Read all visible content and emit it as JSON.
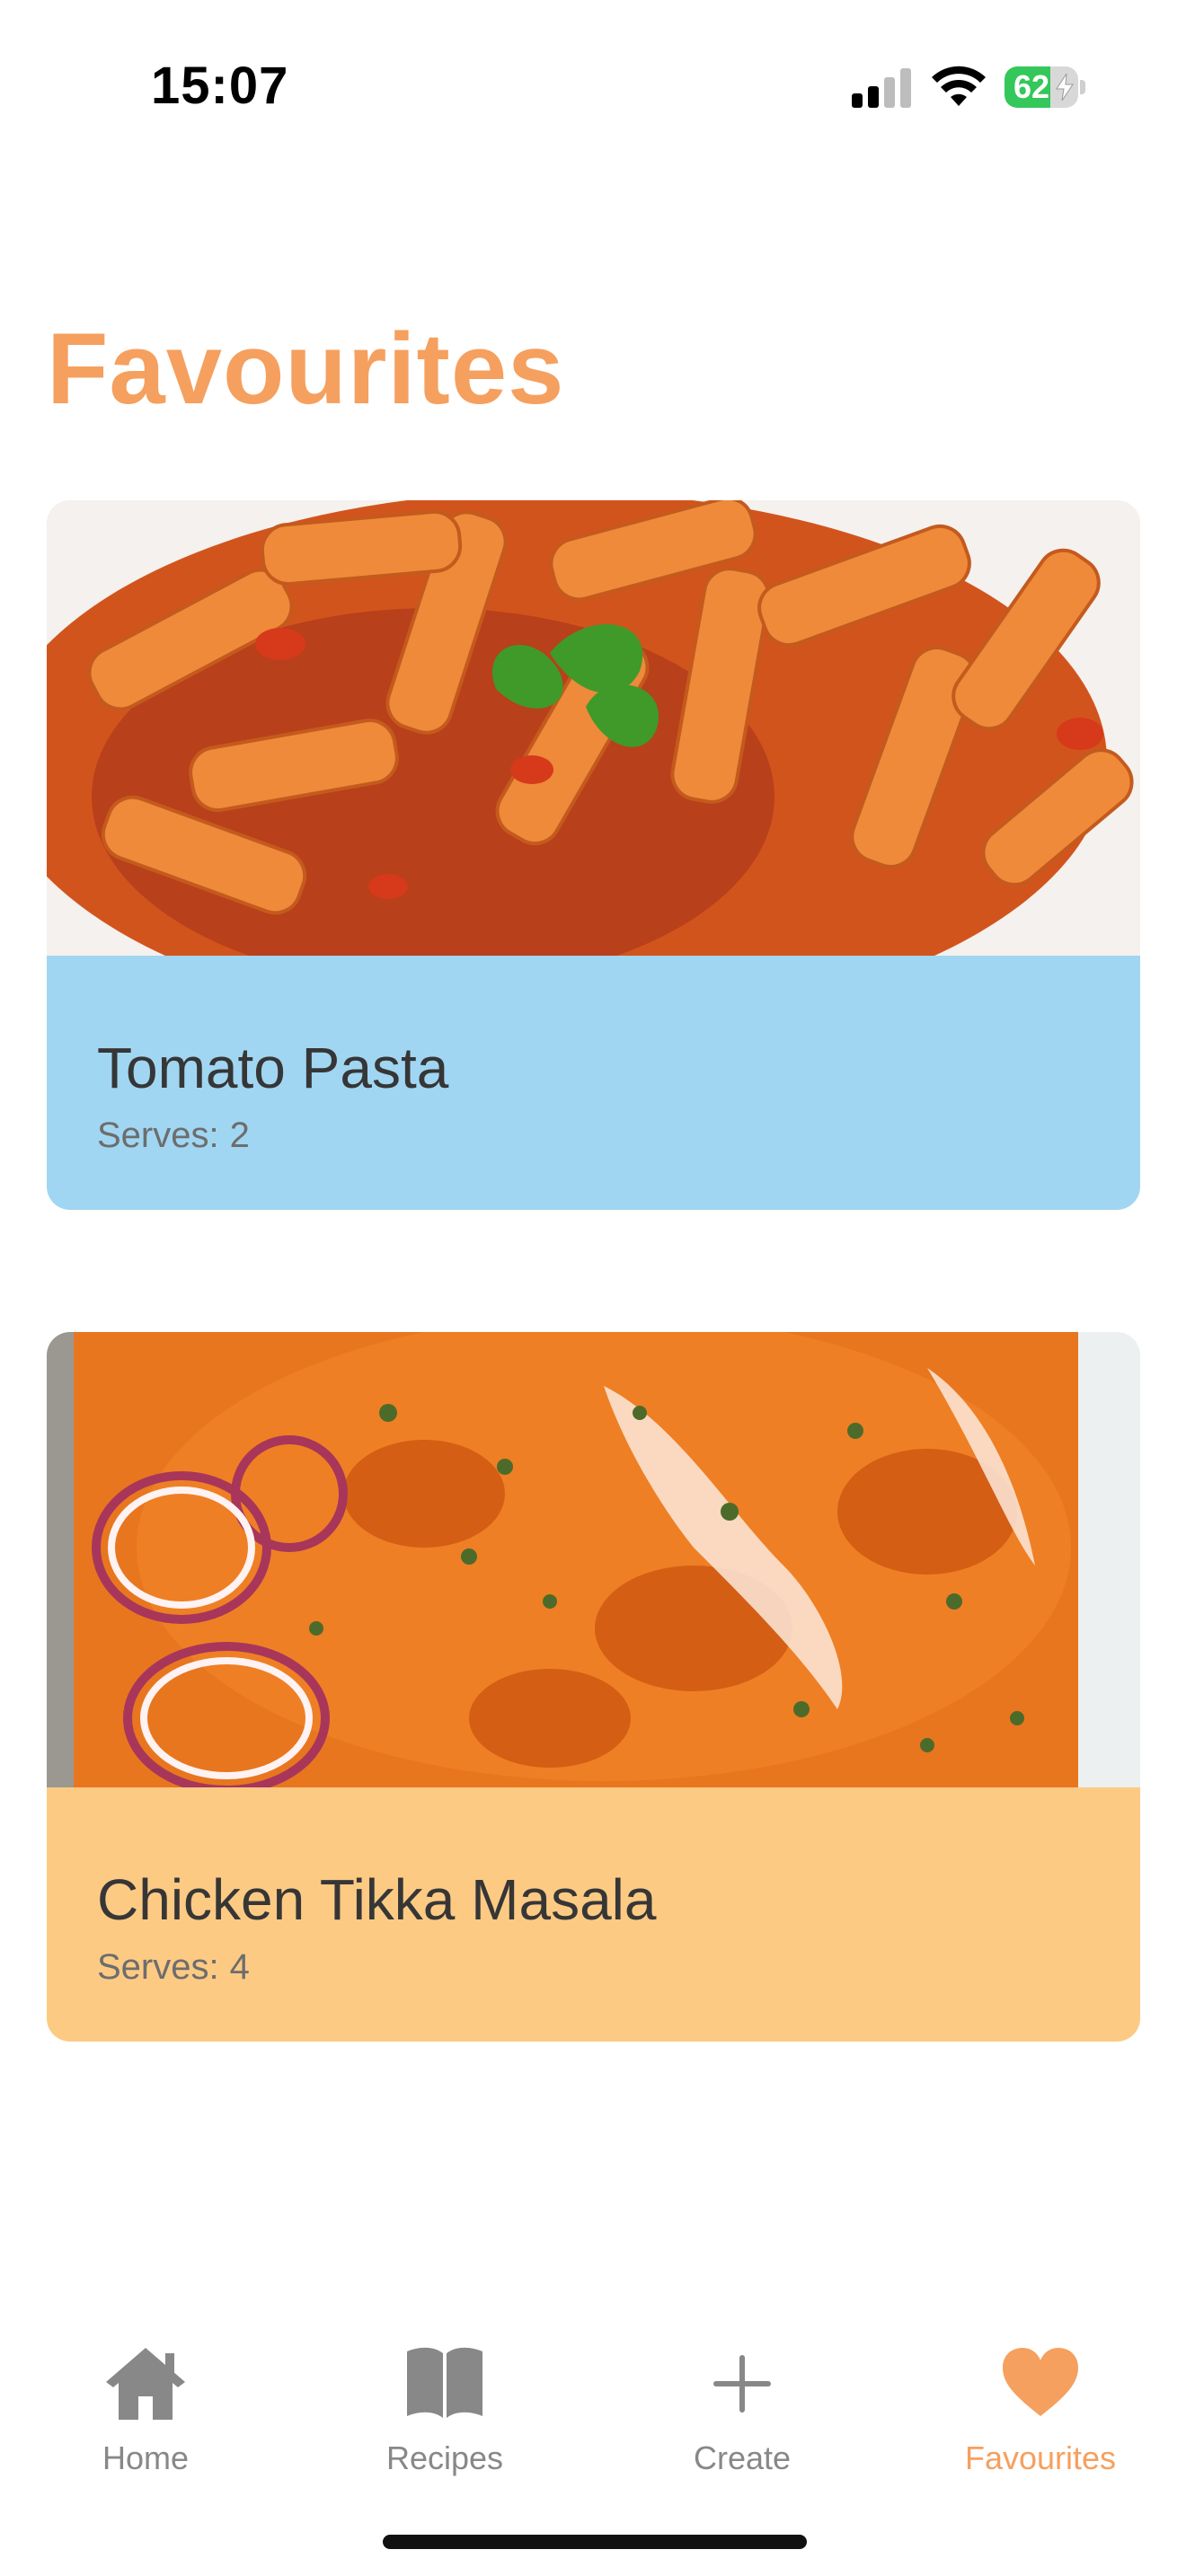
{
  "status_bar": {
    "time": "15:07",
    "battery_level": "62",
    "battery_fill_fraction": 0.62,
    "battery_color": "#34c759",
    "icons": [
      "cellular-signal-icon",
      "wifi-icon",
      "battery-icon",
      "charging-bolt-icon"
    ]
  },
  "page": {
    "title": "Favourites",
    "accent_color": "#f5a05f"
  },
  "recipes": [
    {
      "name": "Tomato Pasta",
      "serves_label": "Serves:",
      "serves": "2",
      "card_color": "#a0d6f2",
      "photo": "tomato-penne-pasta-photo"
    },
    {
      "name": "Chicken Tikka Masala",
      "serves_label": "Serves:",
      "serves": "4",
      "card_color": "#fdca84",
      "photo": "chicken-tikka-masala-photo"
    }
  ],
  "tab_bar": {
    "tabs": [
      {
        "label": "Home",
        "icon": "home-icon",
        "active": false
      },
      {
        "label": "Recipes",
        "icon": "book-icon",
        "active": false
      },
      {
        "label": "Create",
        "icon": "plus-icon",
        "active": false
      },
      {
        "label": "Favourites",
        "icon": "heart-icon",
        "active": true
      }
    ],
    "inactive_color": "#888888",
    "active_color": "#f5a05f"
  }
}
